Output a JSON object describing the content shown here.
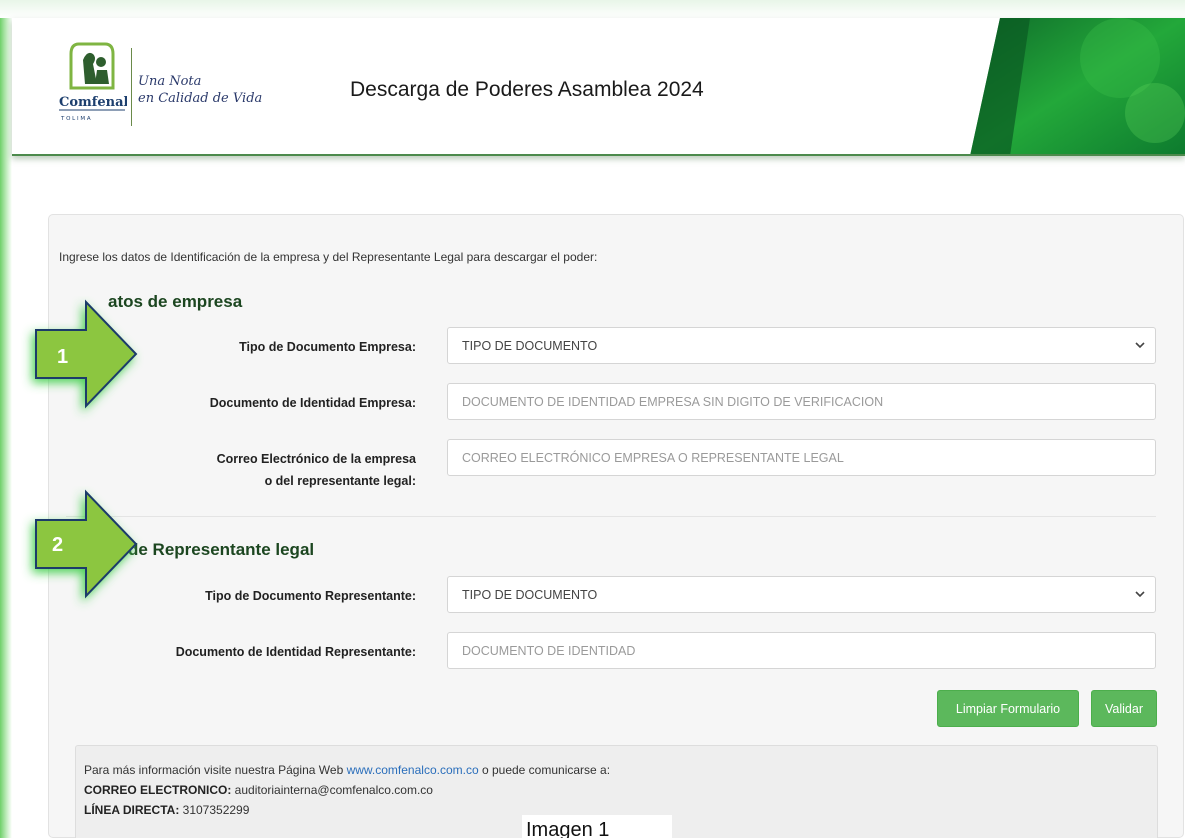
{
  "header": {
    "logo_brand": "Comfenalco",
    "logo_sub": "T O L I M A",
    "slogan_line1": "Una Nota",
    "slogan_line2": "en Calidad de Vida",
    "title": "Descarga de Poderes Asamblea 2024"
  },
  "form": {
    "intro": "Ingrese los datos de Identificación de la empresa y del Representante Legal para descargar el poder:",
    "empresa": {
      "section_title": "atos de empresa",
      "tipo_label": "Tipo de Documento Empresa:",
      "tipo_value": "TIPO DE DOCUMENTO",
      "doc_label": "Documento de Identidad Empresa:",
      "doc_placeholder": "DOCUMENTO DE IDENTIDAD EMPRESA SIN DIGITO DE VERIFICACION",
      "email_label_line1": "Correo Electrónico de la empresa",
      "email_label_line2": "o del representante legal:",
      "email_placeholder": "CORREO ELECTRÓNICO EMPRESA O REPRESENTANTE LEGAL"
    },
    "representante": {
      "section_title": "de Representante legal",
      "tipo_label": "Tipo de Documento Representante:",
      "tipo_value": "TIPO DE DOCUMENTO",
      "doc_label": "Documento de Identidad Representante:",
      "doc_placeholder": "DOCUMENTO DE IDENTIDAD"
    },
    "buttons": {
      "clear": "Limpiar Formulario",
      "validate": "Validar"
    }
  },
  "info": {
    "line1_text": "Para más información visite nuestra Página Web ",
    "line1_link": "www.comfenalco.com.co",
    "line1_suffix": " o puede comunicarse a:",
    "email_label": "CORREO ELECTRONICO:",
    "email_value": " auditoriainterna@comfenalco.com.co",
    "phone_label": "LÍNEA DIRECTA:",
    "phone_value": " 3107352299"
  },
  "annotations": {
    "arrow1": "1",
    "arrow2": "2",
    "caption": "Imagen 1"
  },
  "colors": {
    "brand_green": "#1c4620",
    "button_green": "#5cb85c",
    "arrow_green": "#8cc63f",
    "link_blue": "#2a6ebb"
  }
}
